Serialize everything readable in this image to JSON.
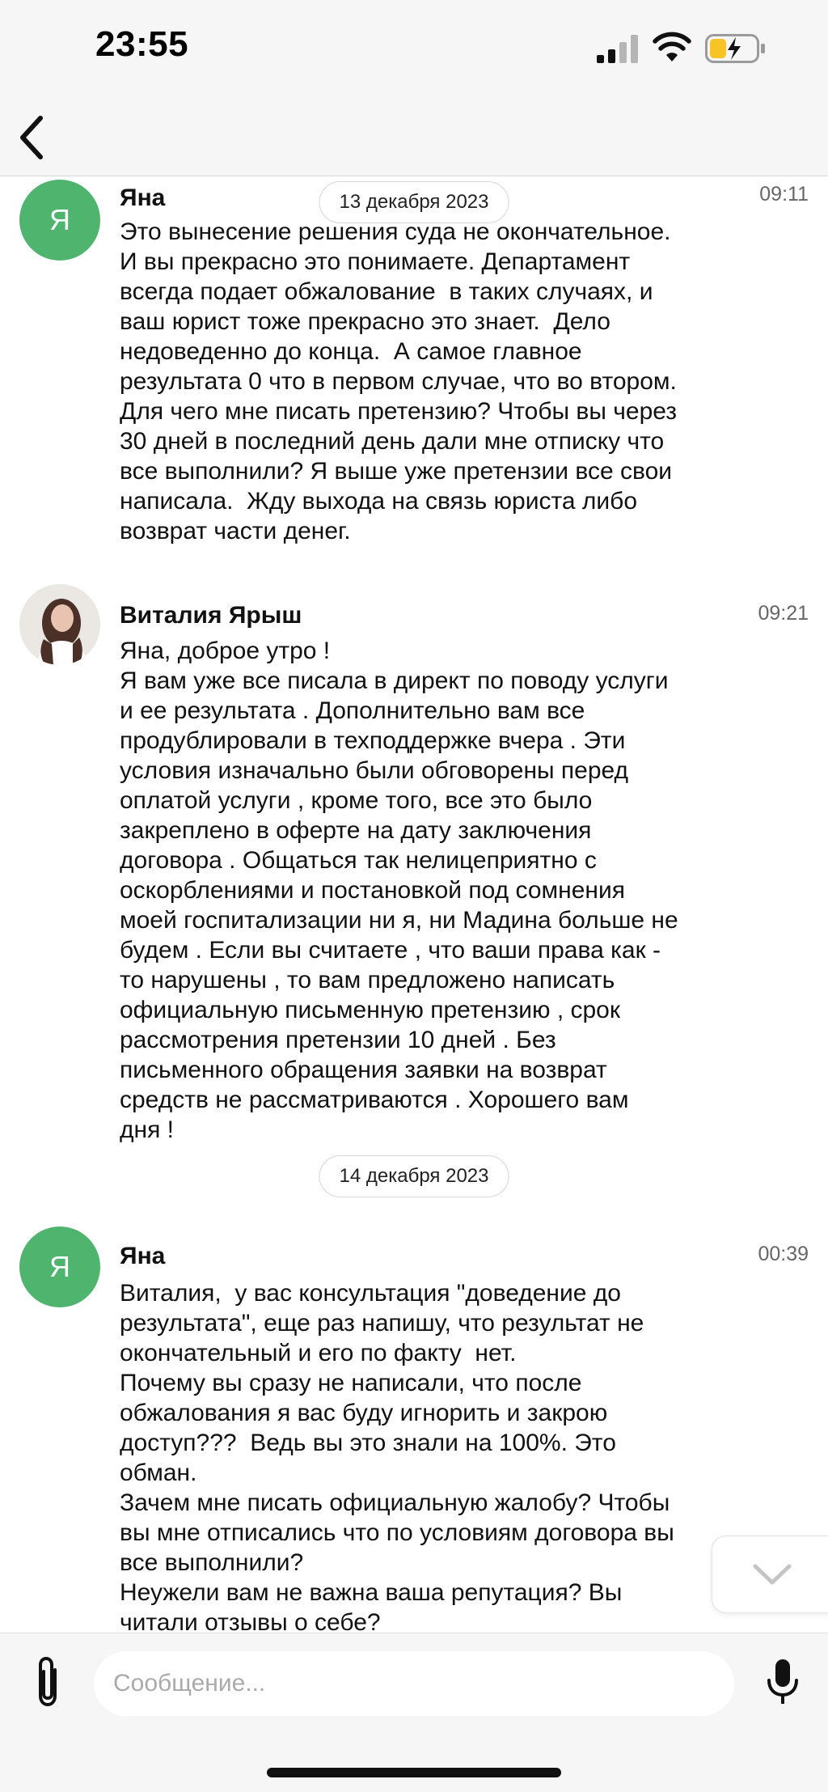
{
  "status_bar": {
    "time": "23:55"
  },
  "header": {
    "back_icon": "chevron-left-icon"
  },
  "dates": {
    "first": "13 декабря 2023",
    "second": "14 декабря 2023"
  },
  "messages": [
    {
      "sender": "Яна",
      "avatar_letter": "Я",
      "time": "09:11",
      "text": "Это вынесение решения суда не окончательное.\nИ вы прекрасно это понимаете. Департамент\nвсегда подает обжалование  в таких случаях, и\nваш юрист тоже прекрасно это знает.  Дело\nнедоведенно до конца.  А самое главное\nрезультата 0 что в первом случае, что во втором.\nДля чего мне писать претензию? Чтобы вы через\n30 дней в последний день дали мне отписку что\nвсе выполнили? Я выше уже претензии все свои\nнаписала.  Жду выхода на связь юриста либо\nвозврат части денег."
    },
    {
      "sender": "Виталия Ярыш",
      "time": "09:21",
      "text": "Яна, доброе утро !\nЯ вам уже все писала в директ по поводу услуги\nи ее результата . Дополнительно вам все\nпродублировали в техподдержке вчера . Эти\nусловия изначально были обговорены перед\nоплатой услуги , кроме того, все это было\nзакреплено в оферте на дату заключения\nдоговора . Общаться так нелицеприятно с\nоскорблениями и постановкой под сомнения\nмоей госпитализации ни я, ни Мадина больше не\nбудем . Если вы считаете , что ваши права как -\nто нарушены , то вам предложено написать\nофициальную письменную претензию , срок\nрассмотрения претензии 10 дней . Без\nписьменного обращения заявки на возврат\nсредств не рассматриваются . Хорошего вам\nдня !"
    },
    {
      "sender": "Яна",
      "avatar_letter": "Я",
      "time": "00:39",
      "text": "Виталия,  у вас консультация \"доведение до\nрезультата\", еще раз напишу, что результат не\nокончательный и его по факту  нет.\nПочему вы сразу не написали, что после\nобжалования я вас буду игнорить и закрою\nдоступ???  Ведь вы это знали на 100%. Это\nобман.\nЗачем мне писать официальную жалобу? Чтобы\nвы мне отписались что по условиям договора вы\nвсе выполнили?\nНеужели вам не важна ваша репутация? Вы\nчитали отзывы о себе?"
    }
  ],
  "composer": {
    "placeholder": "Сообщение..."
  }
}
